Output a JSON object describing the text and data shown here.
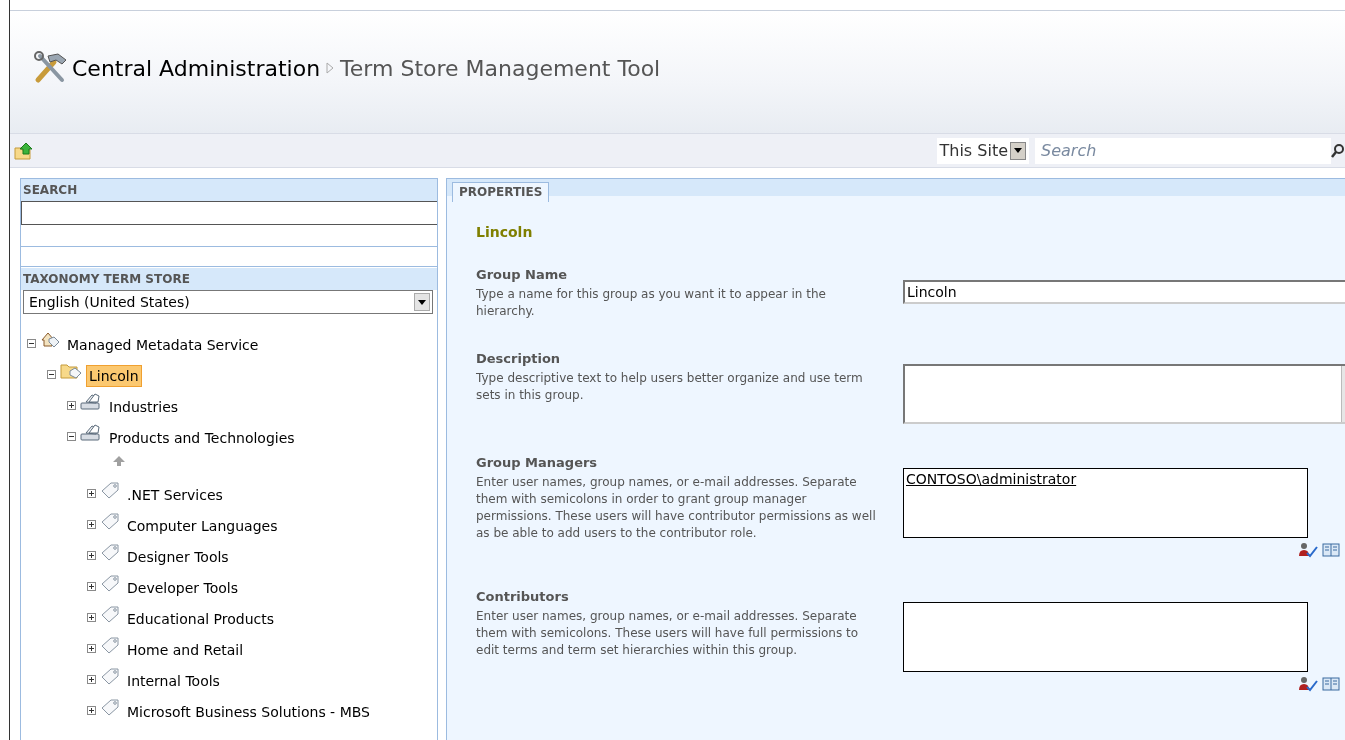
{
  "header": {
    "site": "Central Administration",
    "page": "Term Store Management Tool"
  },
  "site_search": {
    "scope": "This Site",
    "placeholder": "Search"
  },
  "left_panel": {
    "search_label": "SEARCH",
    "store_label": "TAXONOMY TERM STORE",
    "language": "English (United States)"
  },
  "tree": [
    {
      "label": "Managed Metadata Service",
      "kind": "service",
      "expanded": true,
      "selected": false,
      "children": [
        {
          "label": "Lincoln",
          "kind": "group",
          "expanded": true,
          "selected": true,
          "children": [
            {
              "label": "Industries",
              "kind": "termset",
              "expanded": false,
              "selected": false
            },
            {
              "label": "Products and Technologies",
              "kind": "termset",
              "expanded": true,
              "selected": false,
              "children": [
                {
                  "label": ".NET Services",
                  "kind": "term",
                  "expanded": false,
                  "selected": false
                },
                {
                  "label": "Computer Languages",
                  "kind": "term",
                  "expanded": false,
                  "selected": false
                },
                {
                  "label": "Designer Tools",
                  "kind": "term",
                  "expanded": false,
                  "selected": false
                },
                {
                  "label": "Developer Tools",
                  "kind": "term",
                  "expanded": false,
                  "selected": false
                },
                {
                  "label": "Educational Products",
                  "kind": "term",
                  "expanded": false,
                  "selected": false
                },
                {
                  "label": "Home and Retail",
                  "kind": "term",
                  "expanded": false,
                  "selected": false
                },
                {
                  "label": "Internal Tools",
                  "kind": "term",
                  "expanded": false,
                  "selected": false
                },
                {
                  "label": "Microsoft Business Solutions - MBS",
                  "kind": "term",
                  "expanded": false,
                  "selected": false
                }
              ]
            }
          ]
        }
      ]
    }
  ],
  "properties": {
    "tab": "PROPERTIES",
    "heading": "Lincoln",
    "sections": [
      {
        "title": "Group Name",
        "kind": "text",
        "description": "Type a name for this group as you want it to appear in the hierarchy.",
        "value": "Lincoln"
      },
      {
        "title": "Description",
        "kind": "textarea",
        "description": "Type descriptive text to help users better organize and use term sets in this group."
      },
      {
        "title": "Group Managers",
        "kind": "people",
        "description": "Enter user names, group names, or e-mail addresses. Separate them with semicolons in order to grant group manager permissions. These users will have contributor permissions as well as be able to add users to the contributor role.",
        "value": "CONTOSO\\administrator"
      },
      {
        "title": "Contributors",
        "kind": "people",
        "description": "Enter user names, group names, or e-mail addresses. Separate them with semicolons. These users will have full permissions to edit terms and term set hierarchies within this group."
      }
    ]
  }
}
